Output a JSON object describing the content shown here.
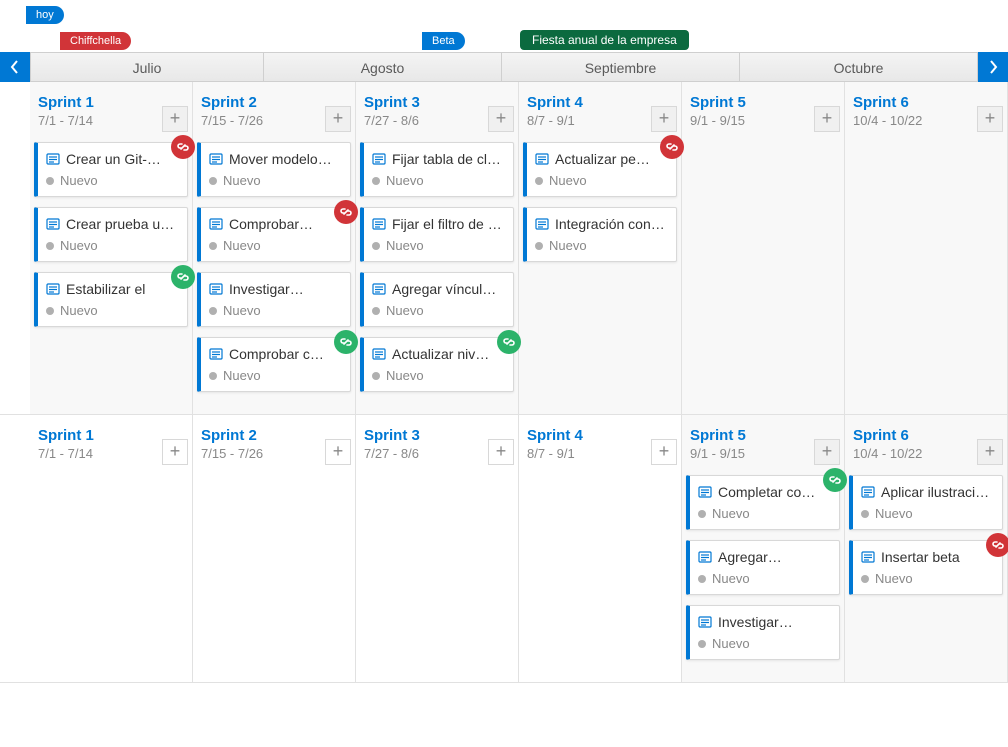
{
  "markers": {
    "today": "hoy",
    "red": "Chiffchella",
    "beta": "Beta",
    "green": "Fiesta anual de la empresa"
  },
  "months": [
    "Julio",
    "Agosto",
    "Septiembre",
    "Octubre"
  ],
  "status_label": "Nuevo",
  "lanes": [
    {
      "title": "Sprint 1",
      "dates": "7/1 - 7/14"
    },
    {
      "title": "Sprint 2",
      "dates": "7/15 - 7/26"
    },
    {
      "title": "Sprint 3",
      "dates": "7/27 - 8/6"
    },
    {
      "title": "Sprint 4",
      "dates": "8/7 - 9/1"
    },
    {
      "title": "Sprint 5",
      "dates": "9/1 - 9/15"
    },
    {
      "title": "Sprint 6",
      "dates": "10/4 - 10/22"
    }
  ],
  "board1": {
    "lane0": [
      {
        "t": "Crear un Git-…",
        "link": "red"
      },
      {
        "t": "Crear prueba u…"
      },
      {
        "t": "Estabilizar el",
        "link": "green"
      }
    ],
    "lane1": [
      {
        "t": "Mover modelo…"
      },
      {
        "t": "Comprobar…",
        "link": "red"
      },
      {
        "t": "Investigar…"
      },
      {
        "t": "Comprobar c…",
        "link": "green"
      }
    ],
    "lane2": [
      {
        "t": "Fijar tabla de cl…"
      },
      {
        "t": "Fijar el filtro de …"
      },
      {
        "t": "Agregar víncul…"
      },
      {
        "t": "Actualizar niv…",
        "link": "green"
      }
    ],
    "lane3": [
      {
        "t": "Actualizar pe…",
        "link": "red"
      },
      {
        "t": "Integración con…"
      }
    ],
    "lane4": [],
    "lane5": []
  },
  "board2": {
    "lane0": [],
    "lane1": [],
    "lane2": [],
    "lane3": [],
    "lane4": [
      {
        "t": "Completar co…",
        "link": "green"
      },
      {
        "t": "Agregar…"
      },
      {
        "t": "Investigar…"
      }
    ],
    "lane5": [
      {
        "t": "Aplicar ilustraci…"
      },
      {
        "t": "Insertar beta",
        "link": "red"
      }
    ]
  }
}
